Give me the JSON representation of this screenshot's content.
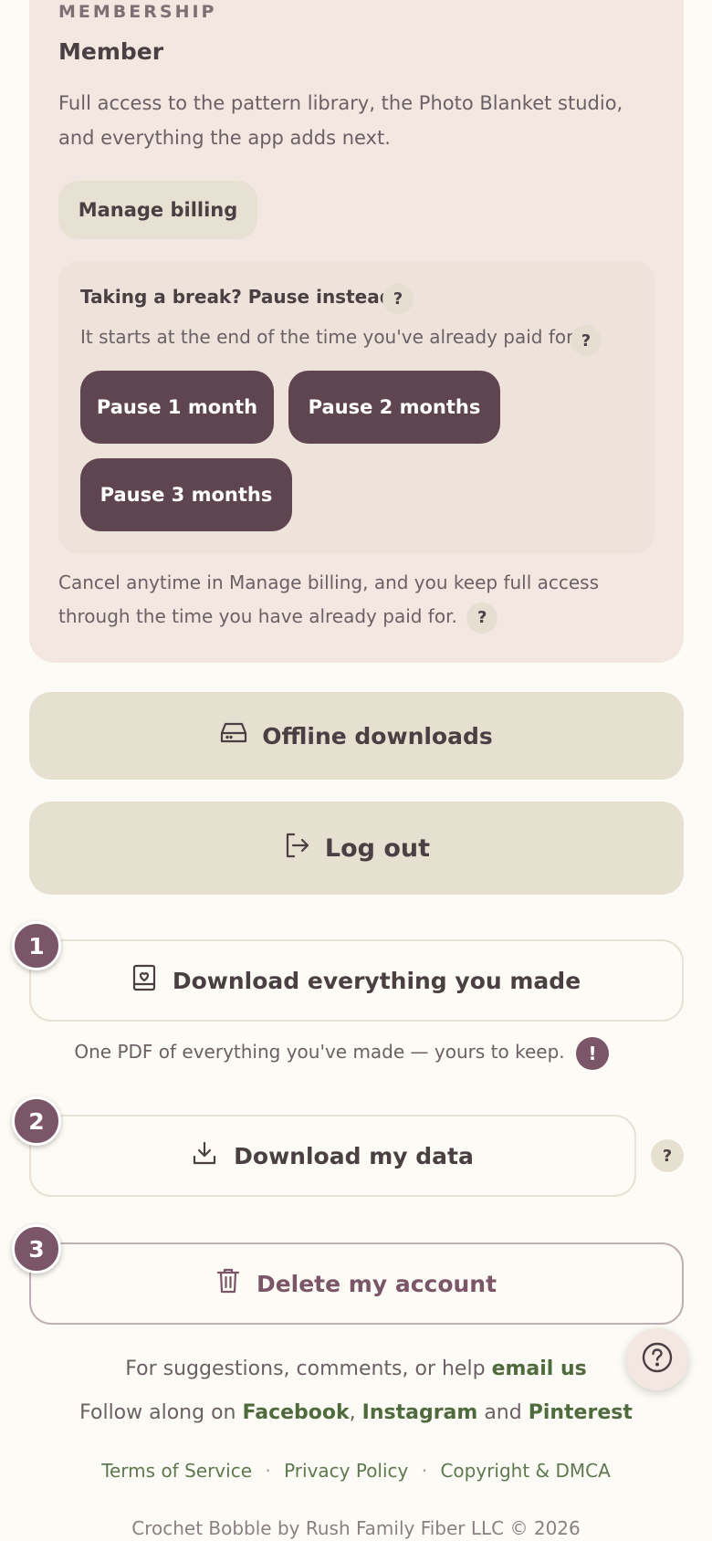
{
  "membership": {
    "eyebrow": "MEMBERSHIP",
    "tier": "Member",
    "description": "Full access to the pattern library, the Photo Blanket studio, and everything the app adds next.",
    "manage_billing_label": "Manage billing",
    "pause": {
      "title": "Taking a break? Pause instead.",
      "subtitle": "It starts at the end of the time you've already paid for.",
      "options": [
        "Pause 1 month",
        "Pause 2 months",
        "Pause 3 months"
      ]
    },
    "cancel_note": "Cancel anytime in Manage billing, and you keep full access through the time you have already paid for."
  },
  "help_mark": "?",
  "alert_mark": "!",
  "actions": {
    "offline_label": "Offline downloads",
    "logout_label": "Log out",
    "download_everything_label": "Download everything you made",
    "download_everything_note": "One PDF of everything you've made — yours to keep.",
    "download_data_label": "Download my data",
    "delete_label": "Delete my account",
    "step_numbers": [
      "1",
      "2",
      "3"
    ]
  },
  "footer": {
    "suggestions_text": "For suggestions, comments, or help",
    "email_link": "email us",
    "follow_text": "Follow along on",
    "facebook": "Facebook",
    "comma": ",",
    "instagram": "Instagram",
    "and_text": "and",
    "pinterest": "Pinterest",
    "legal": [
      "Terms of Service",
      "Privacy Policy",
      "Copyright & DMCA"
    ],
    "separator": "·",
    "copyright": "Crochet Bobble by Rush Family Fiber LLC © 2026"
  },
  "colors": {
    "accent": "#5F4550",
    "danger_text": "#7A5668",
    "link_green": "#4F6B3D",
    "card_bg": "#F3E7E1"
  }
}
